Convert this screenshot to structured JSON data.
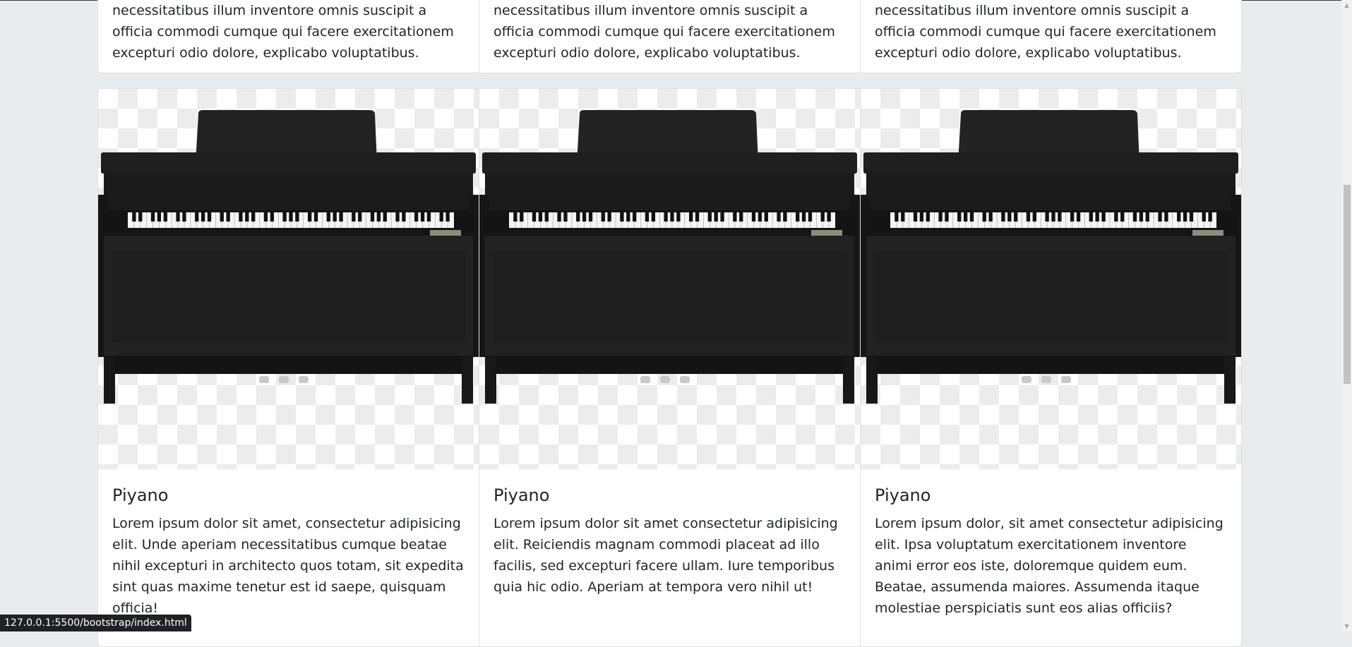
{
  "top_cards": [
    {
      "text": "necessitatibus illum inventore omnis suscipit a officia commodi cumque qui facere exercitationem excepturi odio dolore, explicabo voluptatibus."
    },
    {
      "text": "necessitatibus illum inventore omnis suscipit a officia commodi cumque qui facere exercitationem excepturi odio dolore, explicabo voluptatibus."
    },
    {
      "text": "necessitatibus illum inventore omnis suscipit a officia commodi cumque qui facere exercitationem excepturi odio dolore, explicabo voluptatibus."
    }
  ],
  "cards": [
    {
      "title": "Piyano",
      "text": "Lorem ipsum dolor sit amet, consectetur adipisicing elit. Unde aperiam necessitatibus cumque beatae nihil excepturi in architecto quos totam, sit expedita sint quas maxime tenetur est id saepe, quisquam officia!",
      "brand": "CASIO"
    },
    {
      "title": "Piyano",
      "text": "Lorem ipsum dolor sit amet consectetur adipisicing elit. Reiciendis magnam commodi placeat ad illo facilis, sed excepturi facere ullam. Iure temporibus quia hic odio. Aperiam at tempora vero nihil ut!",
      "brand": "CASIO"
    },
    {
      "title": "Piyano",
      "text": "Lorem ipsum dolor, sit amet consectetur adipisicing elit. Ipsa voluptatum exercitationem inventore animi error eos iste, doloremque quidem eum. Beatae, assumenda maiores. Assumenda itaque molestiae perspiciatis sunt eos alias officiis?",
      "brand": "CASIO"
    }
  ],
  "status_bar": {
    "url": "127.0.0.1:5500/bootstrap/index.html"
  },
  "colors": {
    "page_bg": "#e9ecef",
    "card_border": "#dee2e6",
    "piano_body": "#1f1f1f"
  },
  "icons": {
    "scroll_up": "caret-up-icon",
    "scroll_down": "caret-down-icon"
  }
}
